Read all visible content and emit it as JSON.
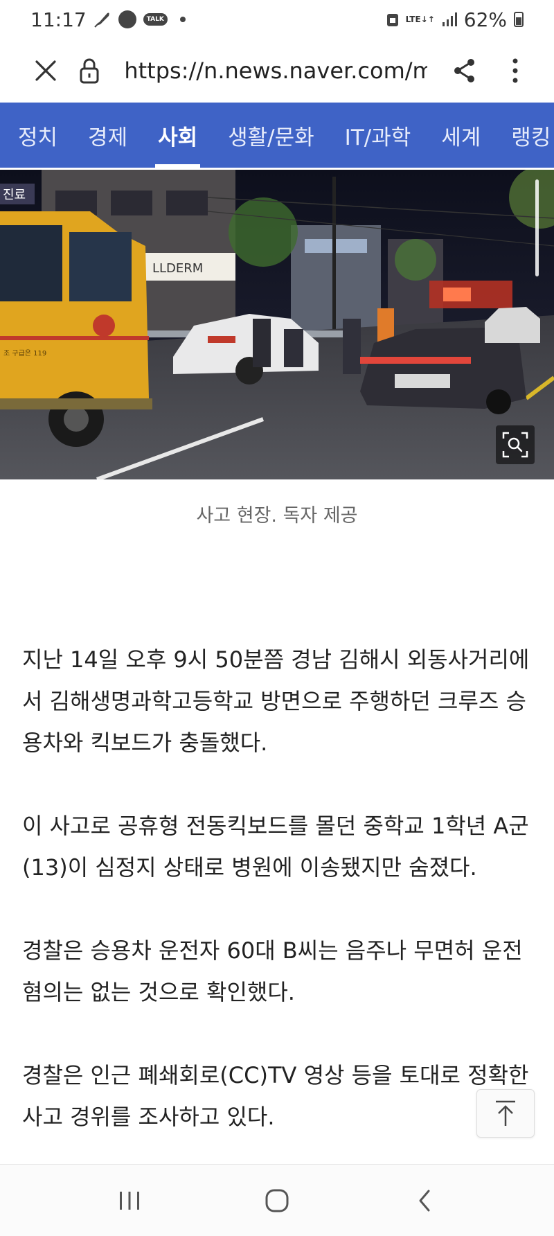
{
  "status": {
    "time": "11:17",
    "talk_label": "TALK",
    "lte_top": "LTE",
    "lte_bottom": "↓↑",
    "battery": "62%"
  },
  "browser": {
    "url": "https://n.news.naver.com/mr"
  },
  "categories": [
    {
      "label": "정치",
      "active": false
    },
    {
      "label": "경제",
      "active": false
    },
    {
      "label": "사회",
      "active": true
    },
    {
      "label": "생활/문화",
      "active": false
    },
    {
      "label": "IT/과학",
      "active": false
    },
    {
      "label": "세계",
      "active": false
    },
    {
      "label": "랭킹",
      "active": false
    }
  ],
  "photo": {
    "sign_store": "LLDERM",
    "truck_sign": "진료",
    "truck_door_text": "조 구급은 119",
    "caption": "사고 현장. 독자 제공"
  },
  "article": {
    "paragraphs": [
      "지난 14일 오후 9시 50분쯤 경남 김해시 외동사거리에서 김해생명과학고등학교 방면으로 주행하던 크루즈 승용차와 킥보드가 충돌했다.",
      "이 사고로 공휴형 전동킥보드를 몰던 중학교 1학년 A군(13)이 심정지 상태로 병원에 이송됐지만 숨졌다.",
      "경찰은 승용차 운전자 60대 B씨는 음주나 무면허 운전 혐의는 없는 것으로 확인했다.",
      "경찰은 인근 폐쇄회로(CC)TV 영상 등을 토대로 정확한 사고 경위를 조사하고 있다."
    ]
  },
  "colors": {
    "nav_bg": "#3f63c6",
    "text": "#222222",
    "caption": "#666666"
  },
  "icons": {
    "close": "close-icon",
    "lock": "lock-icon",
    "share": "share-icon",
    "menu": "more-vert-icon",
    "zoom": "zoom-search-icon",
    "top": "scroll-to-top-icon",
    "recents": "recents-icon",
    "home": "home-icon",
    "back": "back-icon"
  }
}
